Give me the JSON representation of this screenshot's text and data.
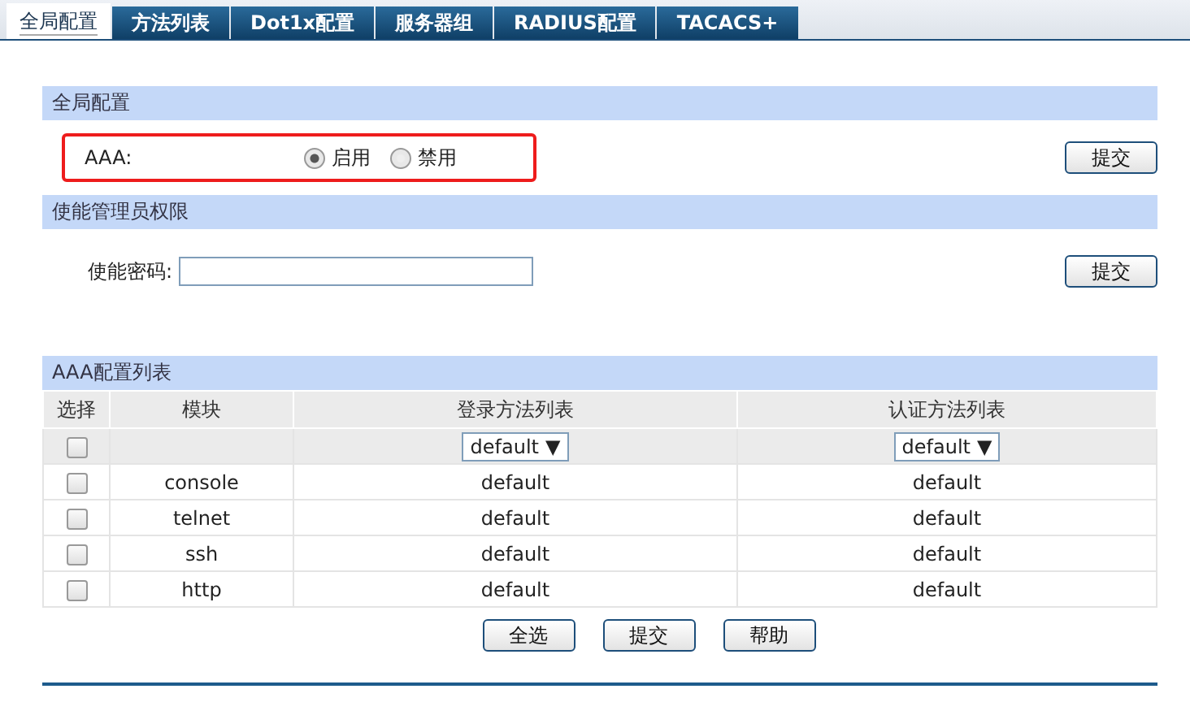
{
  "tabs": [
    {
      "label": "全局配置",
      "selected": true
    },
    {
      "label": "方法列表",
      "selected": false
    },
    {
      "label": "Dot1x配置",
      "selected": false
    },
    {
      "label": "服务器组",
      "selected": false
    },
    {
      "label": "RADIUS配置",
      "selected": false
    },
    {
      "label": "TACACS+",
      "selected": false
    }
  ],
  "global_config": {
    "title": "全局配置",
    "highlighted": true,
    "label": "AAA:",
    "options": [
      {
        "label": "启用",
        "selected": true
      },
      {
        "label": "禁用",
        "selected": false
      }
    ],
    "submit": "提交"
  },
  "enable_admin": {
    "title": "使能管理员权限",
    "label": "使能密码:",
    "submit": "提交"
  },
  "aaa_table": {
    "title": "AAA配置列表",
    "columns": [
      "选择",
      "模块",
      "登录方法列表",
      "认证方法列表"
    ],
    "filter": {
      "checked": false,
      "login": {
        "value": "default",
        "arrow": "▼"
      },
      "auth": {
        "value": "default",
        "arrow": "▼"
      }
    },
    "rows": [
      {
        "checked": false,
        "module": "console",
        "login": "default",
        "auth": "default"
      },
      {
        "checked": false,
        "module": "telnet",
        "login": "default",
        "auth": "default"
      },
      {
        "checked": false,
        "module": "ssh",
        "login": "default",
        "auth": "default"
      },
      {
        "checked": false,
        "module": "http",
        "login": "default",
        "auth": "default"
      }
    ]
  },
  "buttons": [
    "全选",
    "提交",
    "帮助"
  ]
}
